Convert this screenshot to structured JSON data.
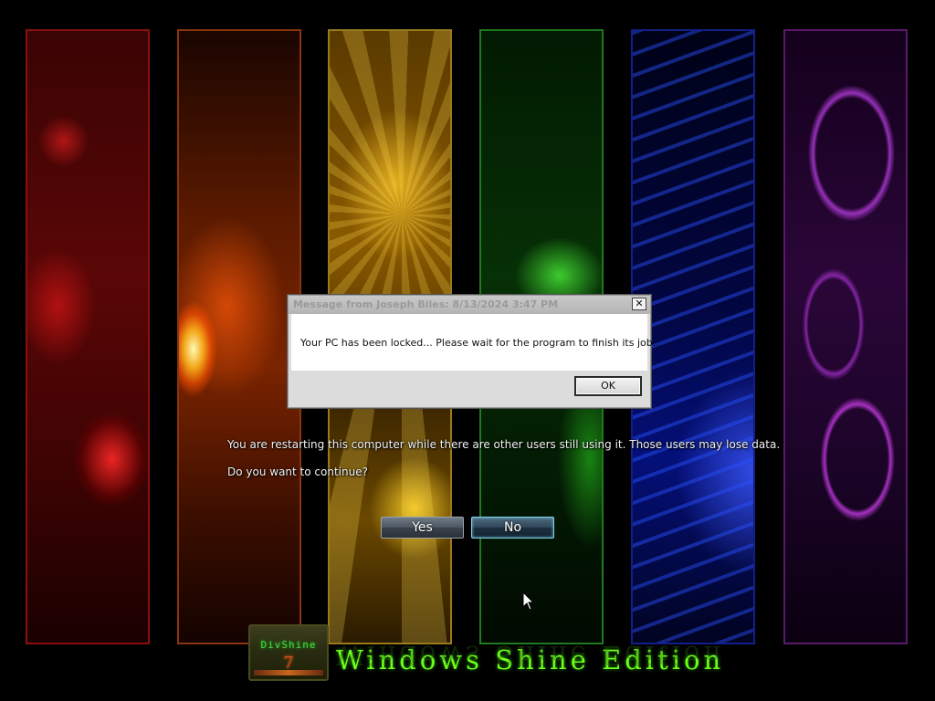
{
  "message_dialog": {
    "title": "Message from Joseph Biles: 8/13/2024 3:47 PM",
    "close_glyph": "✕",
    "message": "Your PC has been locked... Please wait for the program to finish its job...",
    "ok_label": "OK"
  },
  "restart_prompt": {
    "line1": "You are restarting this computer while there are other users still using it. Those users may lose data.",
    "line2": "Do you want to continue?",
    "yes_label": "Yes",
    "no_label": "No"
  },
  "branding": {
    "logo_name": "DivShine",
    "logo_number": "7",
    "title": "Windows Shine Edition"
  },
  "panels": [
    {
      "name": "red",
      "color": "#8a1010"
    },
    {
      "name": "orange",
      "color": "#8a3510"
    },
    {
      "name": "yellow",
      "color": "#9a7a1a"
    },
    {
      "name": "green",
      "color": "#1e7a1e"
    },
    {
      "name": "blue",
      "color": "#121e8a"
    },
    {
      "name": "purple",
      "color": "#5a1a6a"
    }
  ],
  "icons": {
    "close": "close-icon",
    "cursor": "mouse-pointer-icon"
  }
}
